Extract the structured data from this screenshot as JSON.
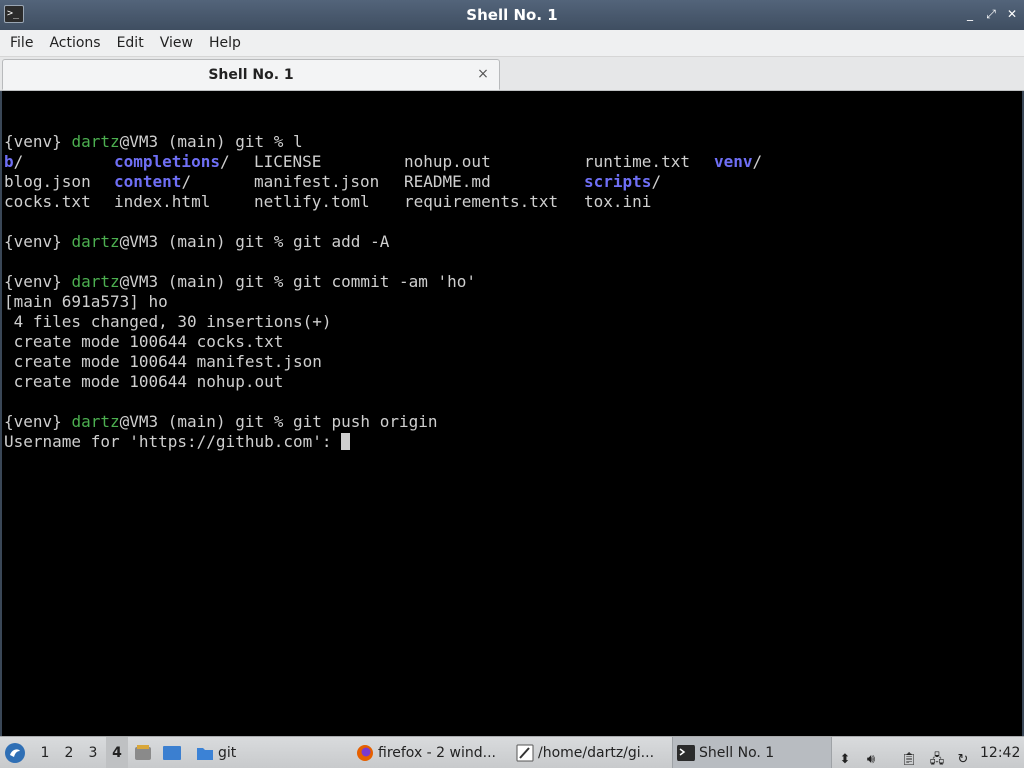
{
  "window": {
    "title": "Shell No. 1",
    "controls": [
      "_",
      "⤢",
      "✕"
    ]
  },
  "menu": [
    "File",
    "Actions",
    "Edit",
    "View",
    "Help"
  ],
  "tab": {
    "label": "Shell No. 1",
    "close": "×"
  },
  "terminal": {
    "prompt": {
      "env": "{venv}",
      "user": "dartz",
      "host": "@VM3",
      "rest": " (main) git % "
    },
    "commands": [
      "l",
      "git add -A",
      "git commit -am 'ho'",
      "git push origin"
    ],
    "ls": [
      [
        {
          "t": "b",
          "d": true,
          "s": "/"
        },
        {
          "t": "completions",
          "d": true,
          "s": "/"
        },
        {
          "t": "LICENSE"
        },
        {
          "t": "nohup.out"
        },
        {
          "t": "runtime.txt"
        },
        {
          "t": "venv",
          "d": true,
          "s": "/"
        }
      ],
      [
        {
          "t": "blog.json"
        },
        {
          "t": "content",
          "d": true,
          "s": "/"
        },
        {
          "t": "manifest.json"
        },
        {
          "t": "README.md"
        },
        {
          "t": "scripts",
          "d": true,
          "s": "/"
        }
      ],
      [
        {
          "t": "cocks.txt"
        },
        {
          "t": "index.html"
        },
        {
          "t": "netlify.toml"
        },
        {
          "t": "requirements.txt"
        },
        {
          "t": "tox.ini"
        }
      ]
    ],
    "commit_output": [
      "[main 691a573] ho",
      " 4 files changed, 30 insertions(+)",
      " create mode 100644 cocks.txt",
      " create mode 100644 manifest.json",
      " create mode 100644 nohup.out"
    ],
    "username_prompt": "Username for 'https://github.com': "
  },
  "taskbar": {
    "workspaces": [
      "1",
      "2",
      "3",
      "4"
    ],
    "active_workspace": "4",
    "folder_label": "git",
    "tasks": [
      {
        "label": "firefox - 2 wind...",
        "icon": "firefox-icon"
      },
      {
        "label": "/home/dartz/gi...",
        "icon": "text-editor-icon"
      },
      {
        "label": "Shell No. 1",
        "icon": "terminal-icon"
      }
    ],
    "clock": "12:42"
  }
}
